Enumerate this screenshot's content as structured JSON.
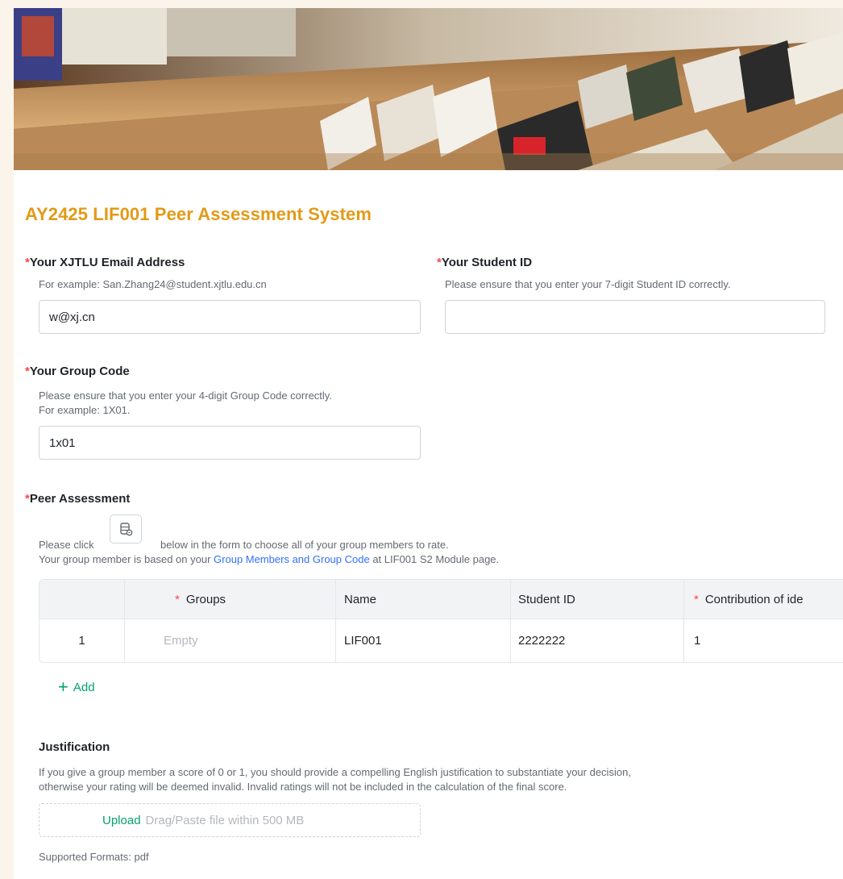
{
  "form": {
    "title": "AY2425 LIF001 Peer Assessment System",
    "required_mark": "*",
    "email": {
      "label": "Your XJTLU Email Address",
      "hint": "For example: San.Zhang24@student.xjtlu.edu.cn",
      "value": "w@xj.cn"
    },
    "student_id": {
      "label": "Your Student ID",
      "hint": "Please ensure that you enter your 7-digit Student ID correctly.",
      "value": ""
    },
    "group_code": {
      "label": "Your Group Code",
      "hint_line1": "Please ensure that you enter your 4-digit Group Code correctly.",
      "hint_line2": "For example: 1X01.",
      "value": "1x01"
    },
    "peer": {
      "label": "Peer Assessment",
      "hint_click_before": "Please click",
      "hint_click_after": "below in the form to choose all of your group members to rate.",
      "hint_group_before": "Your group member is based on your ",
      "hint_group_link": "Group Members and Group Code",
      "hint_group_after": " at LIF001 S2 Module page.",
      "icon": "member-picker-icon",
      "table": {
        "columns": [
          "",
          "Groups",
          "Name",
          "Student ID",
          "Contribution of ide"
        ],
        "rows": [
          {
            "index": "1",
            "groups": "Empty",
            "name": "LIF001",
            "student_id": "2222222",
            "contribution": "1"
          }
        ]
      },
      "add_label": "Add"
    },
    "justification": {
      "label": "Justification",
      "hint_line1": "If you give a group member a score of 0 or 1, you should provide a compelling English justification to substantiate your decision,",
      "hint_line2": "otherwise your rating will be deemed invalid. Invalid ratings will not be included in the calculation of the final score.",
      "upload_link": "Upload",
      "upload_hint": "Drag/Paste file within 500 MB",
      "formats": "Supported Formats: pdf"
    }
  },
  "colors": {
    "title": "#e29a16",
    "required": "#f54a45",
    "link": "#3370ff",
    "accent_green": "#00a36b",
    "page_bg": "#faf4ea"
  }
}
